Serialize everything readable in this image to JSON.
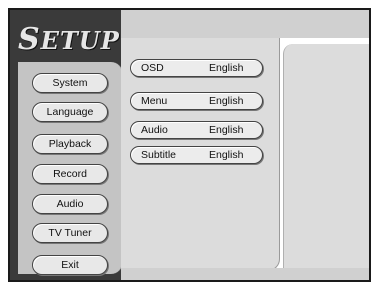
{
  "header": {
    "title_first": "S",
    "title_rest": "ETUP"
  },
  "sidebar": {
    "items": [
      {
        "label": "System"
      },
      {
        "label": "Language",
        "selected": true
      },
      {
        "label": "Playback"
      },
      {
        "label": "Record"
      },
      {
        "label": "Audio"
      },
      {
        "label": "TV Tuner"
      },
      {
        "label": "Exit"
      }
    ]
  },
  "options": [
    {
      "label": "OSD",
      "value": "English"
    },
    {
      "label": "Menu",
      "value": "English"
    },
    {
      "label": "Audio",
      "value": "English"
    },
    {
      "label": "Subtitle",
      "value": "English"
    }
  ],
  "colors": {
    "frame": "#1a1a1a",
    "sidebar_dark": "#3a3a3a",
    "panel": "#dcdcdc",
    "button": "#e8e8e8"
  }
}
